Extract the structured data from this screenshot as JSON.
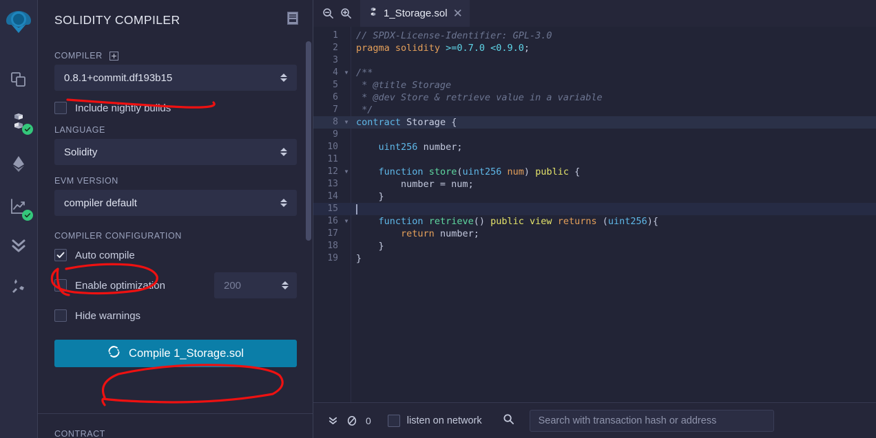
{
  "rail": {
    "logo_name": "remix-logo",
    "items": [
      {
        "name": "file-explorer-icon",
        "label": "File explorers",
        "badge": false
      },
      {
        "name": "solidity-compiler-icon",
        "label": "Solidity compiler",
        "badge": true
      },
      {
        "name": "deploy-run-icon",
        "label": "Deploy & run transactions",
        "badge": false
      },
      {
        "name": "solidity-analyzer-icon",
        "label": "Solidity analyzers",
        "badge": true
      },
      {
        "name": "debugger-icon",
        "label": "Debugger",
        "badge": false
      },
      {
        "name": "plugin-manager-icon",
        "label": "Plugin manager",
        "badge": false
      }
    ]
  },
  "panel": {
    "title": "SOLIDITY COMPILER",
    "header_icon": "article-icon",
    "compiler_label": "COMPILER",
    "compiler_add_icon": "add-custom-compiler-icon",
    "compiler_version": "0.8.1+commit.df193b15",
    "nightly_label": "Include nightly builds",
    "nightly_checked": false,
    "language_label": "LANGUAGE",
    "language_value": "Solidity",
    "evm_label": "EVM VERSION",
    "evm_value": "compiler default",
    "config_label": "COMPILER CONFIGURATION",
    "auto_compile_label": "Auto compile",
    "auto_compile_checked": true,
    "optimization_label": "Enable optimization",
    "optimization_checked": false,
    "runs_value": "200",
    "hide_warnings_label": "Hide warnings",
    "hide_warnings_checked": false,
    "compile_button_label": "Compile 1_Storage.sol",
    "compile_button_icon": "refresh-icon",
    "compile_button_color": "#0b7ea8",
    "contract_label": "CONTRACT"
  },
  "editor": {
    "zoom_out_icon": "zoom-out-icon",
    "zoom_in_icon": "zoom-in-icon",
    "tab": {
      "file_icon": "solidity-file-icon",
      "name": "1_Storage.sol",
      "close_icon": "close-icon"
    },
    "active_line": 15,
    "highlight_line": 8,
    "lines": [
      {
        "n": 1,
        "fold": false,
        "html": "<span class=\"c-com\">// SPDX-License-Identifier: GPL-3.0</span>"
      },
      {
        "n": 2,
        "fold": false,
        "html": "<span class=\"c-kw\">pragma</span> <span class=\"c-kw\">solidity</span> <span class=\"c-num\">&gt;=0.7.0</span> <span class=\"c-num\">&lt;0.9.0</span><span class=\"c-var\">;</span>"
      },
      {
        "n": 3,
        "fold": false,
        "html": ""
      },
      {
        "n": 4,
        "fold": true,
        "html": "<span class=\"c-com\">/**</span>"
      },
      {
        "n": 5,
        "fold": false,
        "html": "<span class=\"c-com\"> * @title Storage</span>"
      },
      {
        "n": 6,
        "fold": false,
        "html": "<span class=\"c-com\"> * @dev Store &amp; retrieve value in a variable</span>"
      },
      {
        "n": 7,
        "fold": false,
        "html": "<span class=\"c-com\"> */</span>"
      },
      {
        "n": 8,
        "fold": true,
        "html": "<span class=\"c-kw2\">contract</span> <span class=\"c-name\">Storage</span> <span class=\"c-var\">{</span>"
      },
      {
        "n": 9,
        "fold": false,
        "html": ""
      },
      {
        "n": 10,
        "fold": false,
        "html": "    <span class=\"c-typ\">uint256</span> <span class=\"c-var\">number;</span>"
      },
      {
        "n": 11,
        "fold": false,
        "html": ""
      },
      {
        "n": 12,
        "fold": true,
        "html": "    <span class=\"c-kw2\">function</span> <span class=\"c-fn\">store</span><span class=\"c-var\">(</span><span class=\"c-typ\">uint256</span> <span class=\"c-ret\">num</span><span class=\"c-var\">)</span> <span class=\"c-mod\">public</span> <span class=\"c-var\">{</span>"
      },
      {
        "n": 13,
        "fold": false,
        "html": "        <span class=\"c-var\">number = num;</span>"
      },
      {
        "n": 14,
        "fold": false,
        "html": "    <span class=\"c-var\">}</span>"
      },
      {
        "n": 15,
        "fold": false,
        "html": ""
      },
      {
        "n": 16,
        "fold": true,
        "html": "    <span class=\"c-kw2\">function</span> <span class=\"c-fn\">retrieve</span><span class=\"c-var\">()</span> <span class=\"c-mod\">public</span> <span class=\"c-mod\">view</span> <span class=\"c-ret\">returns</span> <span class=\"c-var\">(</span><span class=\"c-typ\">uint256</span><span class=\"c-var\">){</span>"
      },
      {
        "n": 17,
        "fold": false,
        "html": "        <span class=\"c-ret\">return</span> <span class=\"c-var\">number;</span>"
      },
      {
        "n": 18,
        "fold": false,
        "html": "    <span class=\"c-var\">}</span>"
      },
      {
        "n": 19,
        "fold": false,
        "html": "<span class=\"c-var\">}</span>"
      }
    ]
  },
  "terminal": {
    "expand_icon": "chevron-double-down-icon",
    "clear_icon": "ban-icon",
    "count": "0",
    "listen_label": "listen on network",
    "listen_checked": false,
    "search_icon": "search-icon",
    "search_placeholder": "Search with transaction hash or address",
    "search_value": ""
  },
  "annotations": {
    "color": "#ee1111",
    "marks": [
      {
        "name": "underline-compiler-version"
      },
      {
        "name": "circle-auto-compile"
      },
      {
        "name": "circle-compile-button"
      }
    ]
  }
}
